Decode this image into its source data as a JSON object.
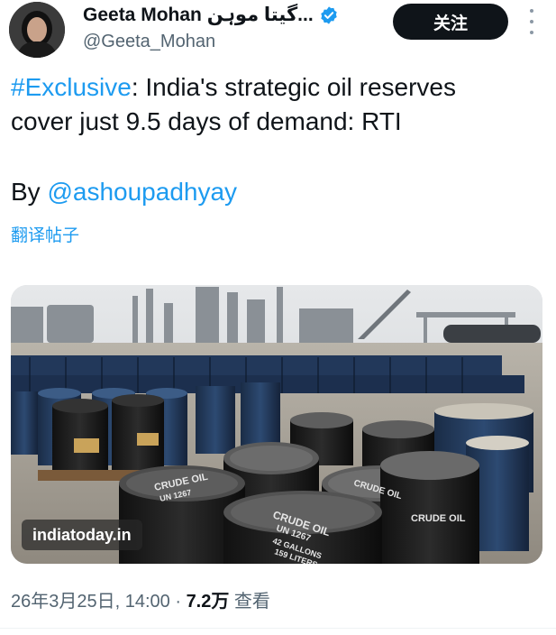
{
  "author": {
    "display_name": "Geeta Mohan گیتا موہن...",
    "handle": "@Geeta_Mohan",
    "verified": true
  },
  "follow_button": {
    "label": "关注"
  },
  "tweet": {
    "hashtag": "#Exclusive",
    "text_after_hashtag": ": India's strategic oil reserves",
    "text_line2": "cover just 9.5 days of demand: RTI",
    "by_prefix": "By ",
    "mention": "@ashoupadhyay",
    "translate_label": "翻译帖子"
  },
  "media": {
    "watermark": "indiatoday.in",
    "barrel_labels": [
      "CRUDE OIL",
      "UN 1267",
      "42 GALLONS",
      "159 LITERS"
    ]
  },
  "meta": {
    "timestamp": "26年3月25日, 14:00",
    "separator": " · ",
    "views_count": "7.2万",
    "views_label": " 查看"
  },
  "colors": {
    "link": "#1d9bf0",
    "verified": "#1d9bf0",
    "text": "#0f1419",
    "muted": "#536471"
  }
}
